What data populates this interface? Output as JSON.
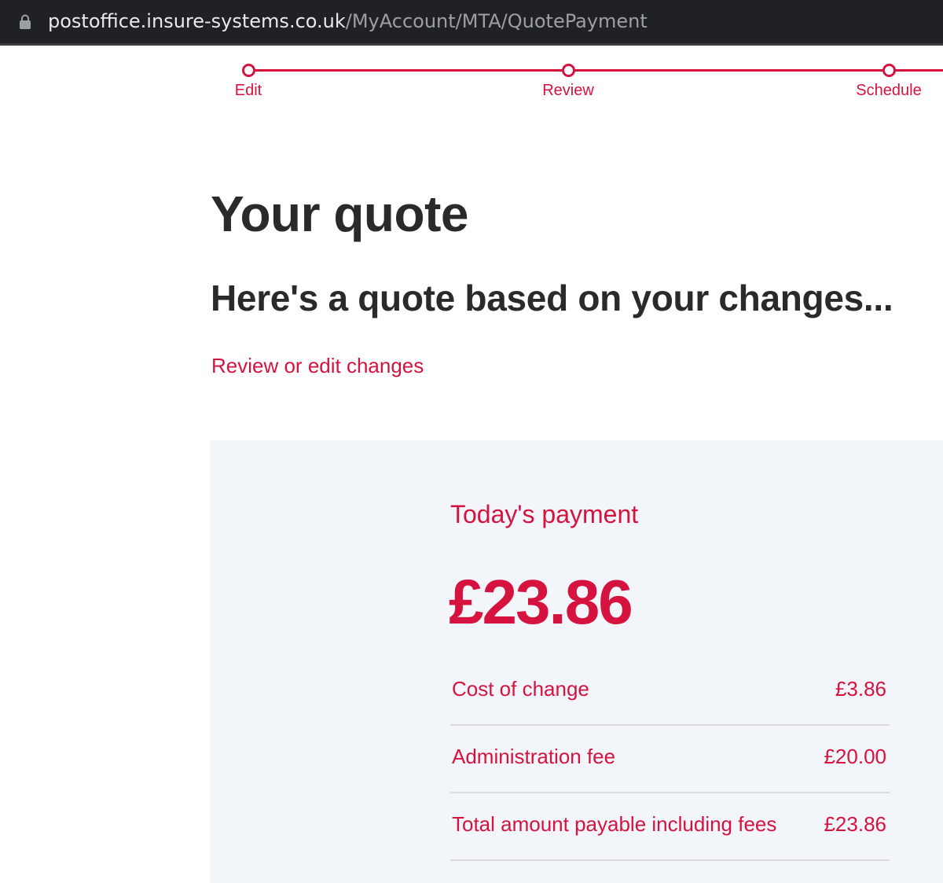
{
  "browser": {
    "url_domain": "postoffice.insure-systems.co.uk",
    "url_path": "/MyAccount/MTA/QuotePayment",
    "lock_icon": "lock-icon"
  },
  "progress": {
    "steps": [
      {
        "label": "Edit"
      },
      {
        "label": "Review"
      },
      {
        "label": "Schedule"
      }
    ]
  },
  "main": {
    "title": "Your quote",
    "subtitle": "Here's a quote based on your changes...",
    "review_link": "Review or edit changes"
  },
  "payment": {
    "heading": "Today's payment",
    "amount": "£23.86",
    "rows": [
      {
        "label": "Cost of change",
        "value": "£3.86"
      },
      {
        "label": "Administration fee",
        "value": "£20.00"
      },
      {
        "label": "Total amount payable including fees",
        "value": "£23.86"
      }
    ]
  },
  "colors": {
    "brand_red": "#d6133f",
    "panel_bg": "#f2f5fa",
    "text_dark": "#2a2a2a",
    "browser_bar": "#202124"
  }
}
